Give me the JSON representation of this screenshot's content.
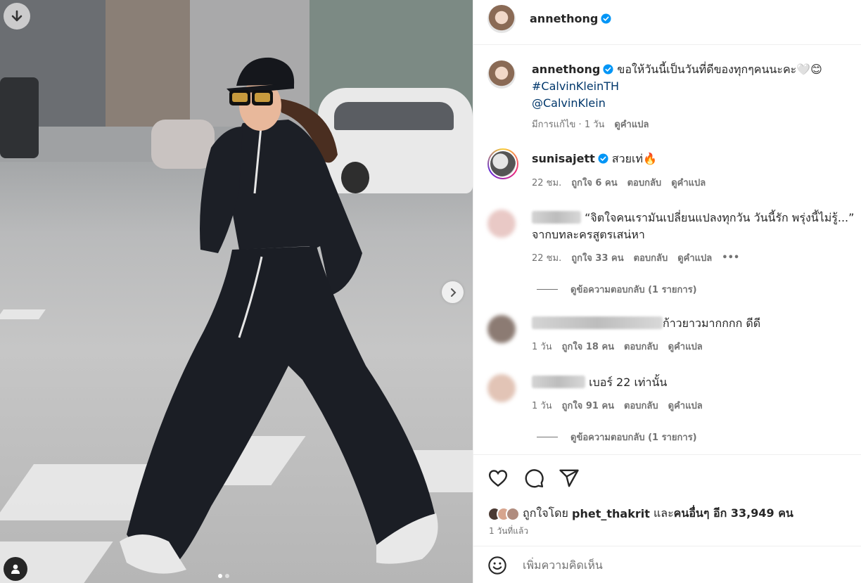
{
  "post": {
    "author": "annethong",
    "caption": "ขอให้วันนี้เป็นวันที่ดีของทุกๆคนนะคะ🤍😊",
    "hashtag": "#CalvinKleinTH",
    "mention": "@CalvinKlein",
    "edited_label": "มีการแก้ไข",
    "time": "1 วัน",
    "translate_label": "ดูคำแปล"
  },
  "comments": [
    {
      "username": "sunisajett",
      "text": "สวยเท่🔥",
      "time": "22 ชม.",
      "likes": "ถูกใจ 6 คน",
      "reply": "ตอบกลับ",
      "translate": "ดูคำแปล"
    },
    {
      "username": "",
      "text": "“จิตใจคนเรามันเปลี่ยนแปลงทุกวัน วันนี้รัก พรุ่งนี้ไม่รู้...” จากบทละครสูตรเสน่หา",
      "time": "22 ชม.",
      "likes": "ถูกใจ 33 คน",
      "reply": "ตอบกลับ",
      "translate": "ดูคำแปล",
      "more": "•••",
      "view_replies": "ดูข้อความตอบกลับ (1 รายการ)"
    },
    {
      "username": "",
      "text": "ก้าวยาวมากกกก ดีดี",
      "time": "1 วัน",
      "likes": "ถูกใจ 18 คน",
      "reply": "ตอบกลับ",
      "translate": "ดูคำแปล"
    },
    {
      "username": "",
      "text": "เบอร์ 22 เท่านั้น",
      "time": "1 วัน",
      "likes": "ถูกใจ 91 คน",
      "reply": "ตอบกลับ",
      "translate": "ดูคำแปล",
      "view_replies": "ดูข้อความตอบกลับ (1 รายการ)"
    }
  ],
  "likes_line": {
    "prefix": "ถูกใจโดย",
    "user": "phet_thakrit",
    "middle": "และ",
    "others": "คนอื่นๆ อีก 33,949 คน"
  },
  "posted_ago": "1 วันที่แล้ว",
  "comment_placeholder": "เพิ่มความคิดเห็น",
  "colors": {
    "verified": "#0095f6",
    "link": "#00376b",
    "muted": "#737373"
  },
  "icons": [
    "download-icon",
    "chevron-right-icon",
    "user-tag-icon",
    "heart-icon",
    "comment-icon",
    "share-icon",
    "emoji-icon",
    "verified-icon"
  ]
}
